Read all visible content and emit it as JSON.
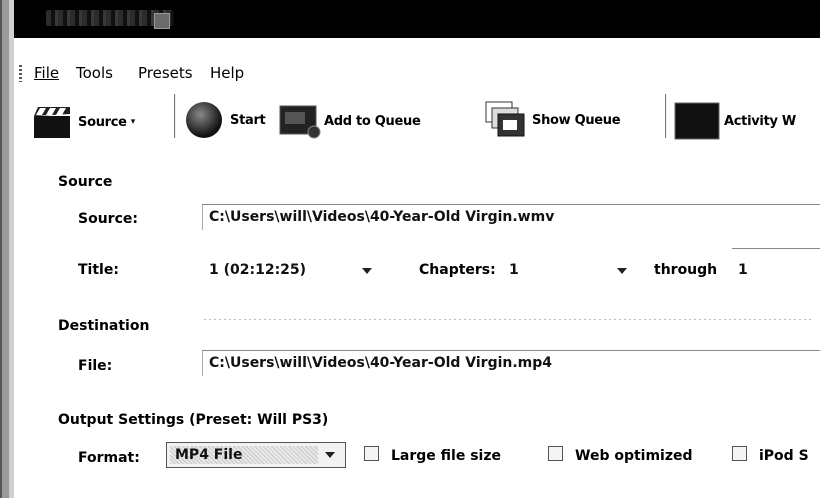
{
  "window": {
    "title_icon": "window-icon"
  },
  "menu": [
    {
      "label": "File",
      "mnemonic": "F"
    },
    {
      "label": "Tools",
      "mnemonic": "T"
    },
    {
      "label": "Presets",
      "mnemonic": "P"
    },
    {
      "label": "Help",
      "mnemonic": "H"
    }
  ],
  "toolbar": {
    "source": "Source",
    "start": "Start",
    "add_queue": "Add to Queue",
    "show_queue": "Show Queue",
    "activity": "Activity W"
  },
  "source_section": {
    "heading": "Source",
    "source_label": "Source:",
    "source_path": "C:\\Users\\will\\Videos\\40-Year-Old Virgin.wmv",
    "title_label": "Title:",
    "title_value": "1 (02:12:25)",
    "chapters_label": "Chapters:",
    "chapters_from": "1",
    "through_label": "through",
    "chapters_to": "1"
  },
  "destination_section": {
    "heading": "Destination",
    "file_label": "File:",
    "file_path": "C:\\Users\\will\\Videos\\40-Year-Old Virgin.mp4"
  },
  "output_section": {
    "heading": "Output Settings (Preset: Will PS3)",
    "format_label": "Format:",
    "format_value": "MP4 File",
    "large_file": "Large file size",
    "web_optimized": "Web optimized",
    "ipod": "iPod S"
  }
}
